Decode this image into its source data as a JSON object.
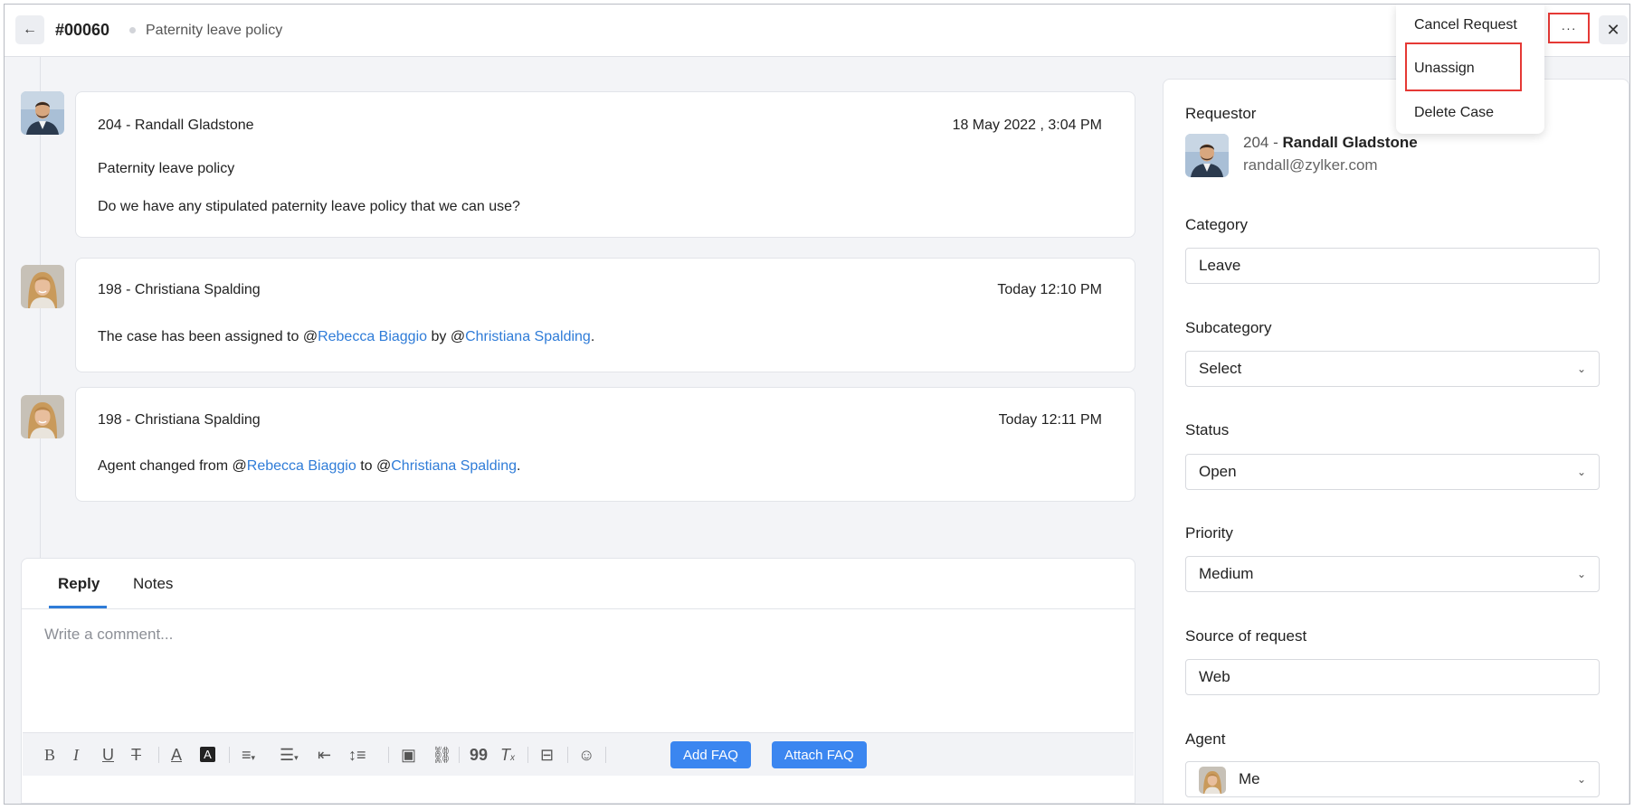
{
  "header": {
    "back_icon": "arrow-left-icon",
    "case_id": "#00060",
    "case_title": "Paternity leave policy",
    "more_label": "···",
    "close_label": "✕"
  },
  "more_menu": {
    "items": [
      "Cancel Request",
      "Unassign",
      "Delete Case"
    ]
  },
  "messages": [
    {
      "author": "204 - Randall Gladstone",
      "time": "18 May 2022 , 3:04 PM",
      "subject": "Paternity leave policy",
      "body": "Do we have any stipulated paternity leave policy that we can use?"
    },
    {
      "author": "198 - Christiana Spalding",
      "time": "Today 12:10 PM",
      "body_prefix": "The case has been assigned to @",
      "mention_1": "Rebecca Biaggio",
      "body_mid": " by @",
      "mention_2": "Christiana Spalding",
      "body_suffix": "."
    },
    {
      "author": "198 - Christiana Spalding",
      "time": "Today 12:11 PM",
      "body_prefix": "Agent changed from @",
      "mention_1": "Rebecca Biaggio",
      "body_mid": " to @",
      "mention_2": "Christiana Spalding",
      "body_suffix": "."
    }
  ],
  "reply": {
    "tabs": [
      "Reply",
      "Notes"
    ],
    "placeholder": "Write a comment...",
    "add_faq": "Add FAQ",
    "attach_faq": "Attach FAQ"
  },
  "sidebar": {
    "requestor_label": "Requestor",
    "requestor_id": "204 - ",
    "requestor_name": "Randall Gladstone",
    "requestor_email": "randall@zylker.com",
    "category_label": "Category",
    "category_value": "Leave",
    "subcategory_label": "Subcategory",
    "subcategory_value": "Select",
    "status_label": "Status",
    "status_value": "Open",
    "priority_label": "Priority",
    "priority_value": "Medium",
    "source_label": "Source of request",
    "source_value": "Web",
    "agent_label": "Agent",
    "agent_value": "Me"
  },
  "colors": {
    "accent": "#2f7cd8",
    "button_blue": "#3b86f0",
    "highlight_red": "#e53935"
  }
}
